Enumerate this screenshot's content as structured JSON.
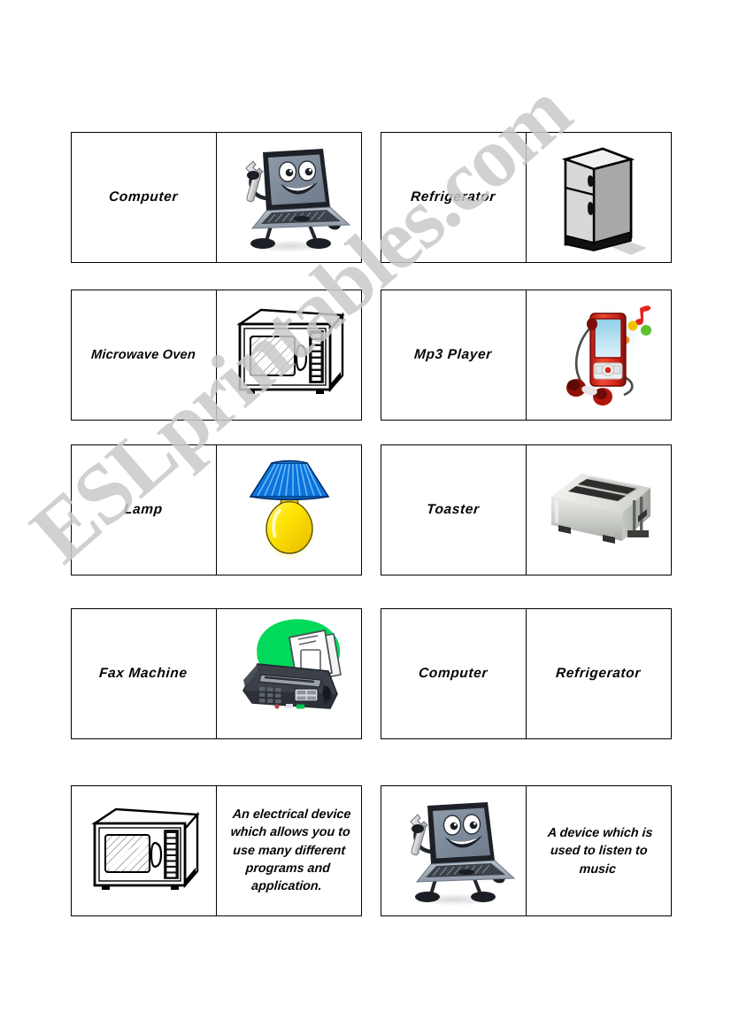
{
  "page": {
    "type": "esl-worksheet-domino-cards",
    "background_color": "#ffffff",
    "watermark": "ESLprintables.com",
    "watermark_color": "#c9c9c9"
  },
  "cards": [
    {
      "row": 1,
      "column": "left",
      "left_half": {
        "kind": "word",
        "text": "Computer"
      },
      "right_half": {
        "kind": "picture",
        "icon": "laptop-character-with-wrench-icon",
        "label": "Computer"
      }
    },
    {
      "row": 1,
      "column": "right",
      "left_half": {
        "kind": "word",
        "text": "Refrigerator"
      },
      "right_half": {
        "kind": "picture",
        "icon": "refrigerator-icon",
        "label": "Refrigerator"
      }
    },
    {
      "row": 2,
      "column": "left",
      "left_half": {
        "kind": "word",
        "text": "Microwave Oven"
      },
      "right_half": {
        "kind": "picture",
        "icon": "microwave-oven-icon",
        "label": "Microwave Oven"
      }
    },
    {
      "row": 2,
      "column": "right",
      "left_half": {
        "kind": "word",
        "text": "Mp3 Player"
      },
      "right_half": {
        "kind": "picture",
        "icon": "mp3-player-with-earbuds-icon",
        "label": "Mp3 Player"
      }
    },
    {
      "row": 3,
      "column": "left",
      "left_half": {
        "kind": "word",
        "text": "Lamp"
      },
      "right_half": {
        "kind": "picture",
        "icon": "table-lamp-icon",
        "label": "Lamp"
      }
    },
    {
      "row": 3,
      "column": "right",
      "left_half": {
        "kind": "word",
        "text": "Toaster"
      },
      "right_half": {
        "kind": "picture",
        "icon": "toaster-icon",
        "label": "Toaster"
      }
    },
    {
      "row": 4,
      "column": "left",
      "left_half": {
        "kind": "word",
        "text": "Fax Machine"
      },
      "right_half": {
        "kind": "picture",
        "icon": "fax-machine-icon",
        "label": "Fax Machine"
      }
    },
    {
      "row": 4,
      "column": "right",
      "left_half": {
        "kind": "word",
        "text": "Computer"
      },
      "right_half": {
        "kind": "word",
        "text": "Refrigerator"
      }
    },
    {
      "row": 5,
      "column": "left",
      "left_half": {
        "kind": "picture",
        "icon": "microwave-oven-icon",
        "label": "Microwave Oven"
      },
      "right_half": {
        "kind": "definition",
        "text": "An electrical device which allows you to use many different programs and application."
      }
    },
    {
      "row": 5,
      "column": "right",
      "left_half": {
        "kind": "picture",
        "icon": "laptop-character-with-wrench-icon",
        "label": "Computer"
      },
      "right_half": {
        "kind": "definition",
        "text": "A device which is used to listen to music"
      }
    }
  ],
  "colors": {
    "ink": "#050505",
    "lamp_shade": "#0a74dc",
    "lamp_base": "#ffe000",
    "mp3_body": "#d8291c",
    "mp3_screen": "#a9dcf2",
    "fax_body": "#3b4049",
    "fax_blob": "#00d95a",
    "toaster_body": "#cfd2cd",
    "fridge_body": "#d3d3d3"
  }
}
